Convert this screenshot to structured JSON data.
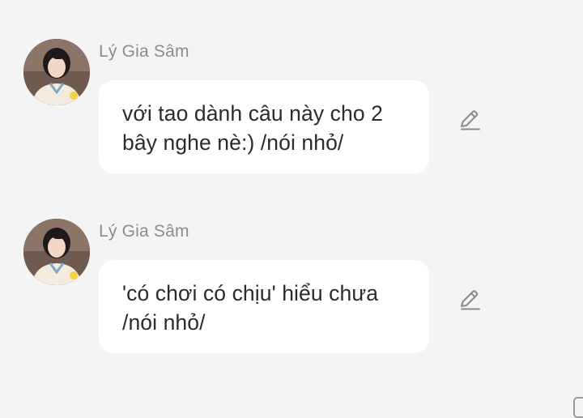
{
  "messages": [
    {
      "sender": "Lý Gia Sâm",
      "text": "với tao dành câu này cho 2 bây nghe nè:) /nói nhỏ/",
      "avatar_icon": "user-avatar",
      "action_icon": "pencil-edit-icon"
    },
    {
      "sender": "Lý Gia Sâm",
      "text": "'có chơi có chịu' hiểu chưa /nói nhỏ/",
      "avatar_icon": "user-avatar",
      "action_icon": "pencil-edit-icon"
    }
  ],
  "colors": {
    "background": "#f4f4f4",
    "bubble": "#ffffff",
    "sender_text": "#8c8c8c",
    "message_text": "#2b2b2b",
    "icon": "#8a8a8a"
  }
}
